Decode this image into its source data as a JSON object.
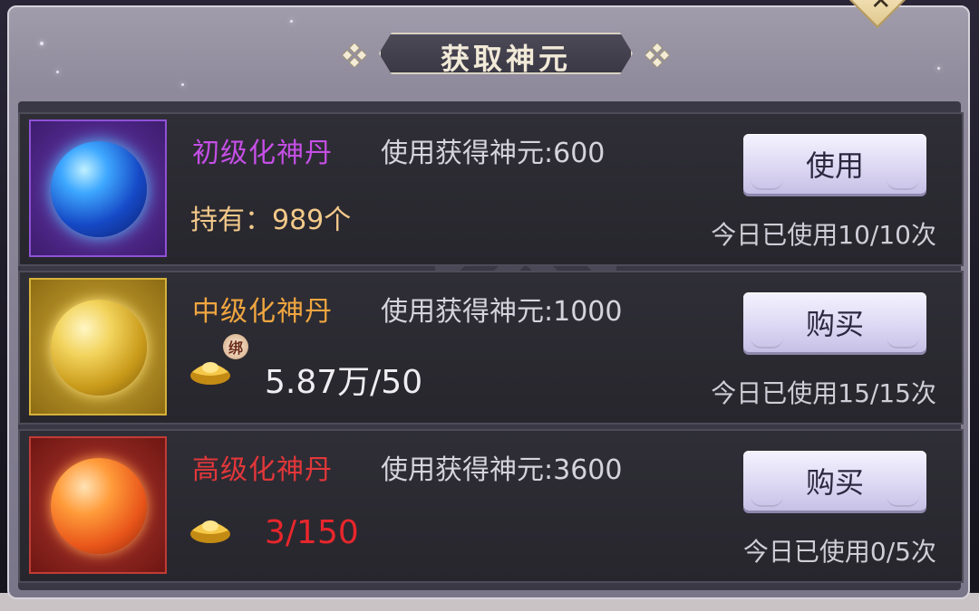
{
  "dialog": {
    "title": "获取神元"
  },
  "items": [
    {
      "name": "初级化神丹",
      "name_color": "#c54fe6",
      "gain_label": "使用获得神元:600",
      "owned_label": "持有：989个",
      "button_label": "使用",
      "daily_usage": "今日已使用10/10次",
      "icon": "blue-orb-icon",
      "frame_color": "#7b3fc2"
    },
    {
      "name": "中级化神丹",
      "name_color": "#f0a640",
      "gain_label": "使用获得神元:1000",
      "price_label": "5.87万/50",
      "price_color": "#f0eef2",
      "bind_badge": "绑",
      "button_label": "购买",
      "daily_usage": "今日已使用15/15次",
      "icon": "gold-orb-icon",
      "frame_color": "#c9a12a"
    },
    {
      "name": "高级化神丹",
      "name_color": "#e2373a",
      "gain_label": "使用获得神元:3600",
      "price_label": "3/150",
      "price_color": "#e8262c",
      "button_label": "购买",
      "daily_usage": "今日已使用0/5次",
      "icon": "orange-orb-icon",
      "frame_color": "#b8312e"
    }
  ]
}
